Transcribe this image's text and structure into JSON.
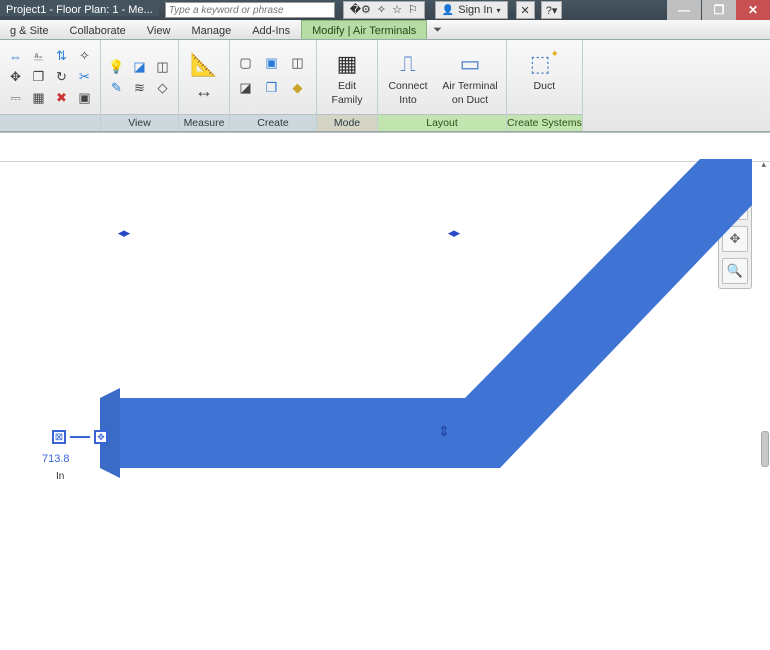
{
  "title": "Project1 - Floor Plan: 1 - Me...",
  "search": {
    "placeholder": "Type a keyword or phrase"
  },
  "signin": {
    "label": "Sign In"
  },
  "tabs": {
    "t0": "g & Site",
    "t1": "Collaborate",
    "t2": "View",
    "t3": "Manage",
    "t4": "Add-Ins",
    "contextual": "Modify | Air Terminals"
  },
  "ribbon": {
    "panel_view": "View",
    "panel_measure": "Measure",
    "panel_create": "Create",
    "panel_mode": "Mode",
    "panel_layout": "Layout",
    "panel_systems": "Create Systems",
    "edit_family": {
      "l1": "Edit",
      "l2": "Family"
    },
    "connect_into": {
      "l1": "Connect",
      "l2": "Into"
    },
    "air_terminal": {
      "l1": "Air Terminal",
      "l2": "on Duct"
    },
    "duct": {
      "l1": "Duct"
    }
  },
  "canvas": {
    "dimension_value": "713.8",
    "dimension_unit": "In"
  }
}
